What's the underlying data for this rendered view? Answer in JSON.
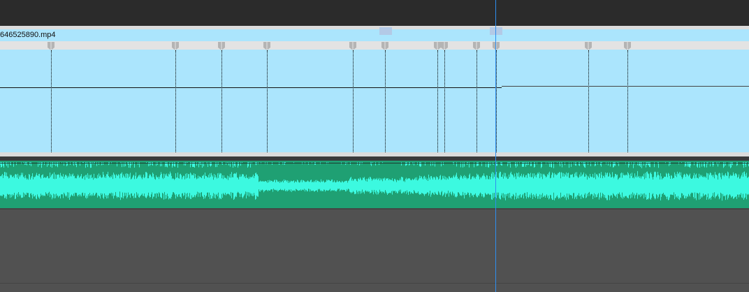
{
  "timeline": {
    "video_clip": {
      "name": "646525890.mp4"
    },
    "colors": {
      "video_clip_bg": "#abe5fd",
      "audio_clip_bg": "#1fa073",
      "waveform": "#3cf9e0",
      "playhead": "#2e8ff0"
    }
  }
}
